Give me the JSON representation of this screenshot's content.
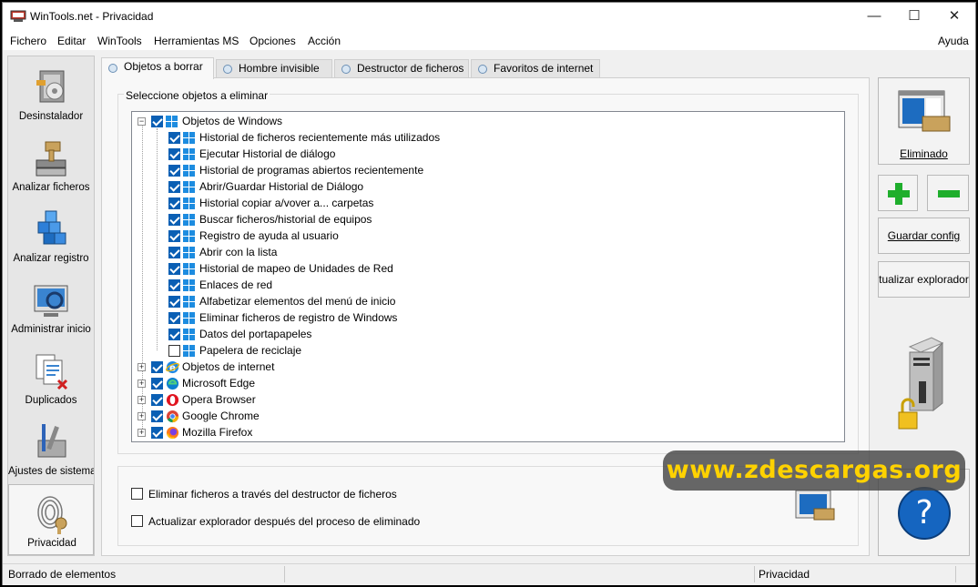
{
  "window": {
    "title": "WinTools.net - Privacidad"
  },
  "menu": {
    "items": [
      "Fichero",
      "Editar",
      "WinTools",
      "Herramientas MS",
      "Opciones",
      "Acción"
    ],
    "help": "Ayuda"
  },
  "sidebar": {
    "items": [
      {
        "label": "Desinstalador",
        "icon": "uninstaller-icon"
      },
      {
        "label": "Analizar ficheros",
        "icon": "file-scanner-icon"
      },
      {
        "label": "Analizar registro",
        "icon": "registry-scanner-icon"
      },
      {
        "label": "Administrar inicio",
        "icon": "startup-manager-icon"
      },
      {
        "label": "Duplicados",
        "icon": "duplicates-icon"
      },
      {
        "label": "Ajustes de sistema",
        "icon": "system-tweaks-icon"
      },
      {
        "label": "Privacidad",
        "icon": "privacy-icon",
        "active": true
      }
    ]
  },
  "tabs": [
    "Objetos a borrar",
    "Hombre invisible",
    "Destructor de ficheros",
    "Favoritos de internet"
  ],
  "group": {
    "title": "Seleccione objetos a eliminar"
  },
  "tree": {
    "root": {
      "label": "Objetos de Windows",
      "checked": true,
      "expanded": true
    },
    "children": [
      {
        "label": "Historial de ficheros recientemente más utilizados",
        "checked": true
      },
      {
        "label": "Ejecutar Historial de diálogo",
        "checked": true
      },
      {
        "label": "Historial de programas abiertos recientemente",
        "checked": true
      },
      {
        "label": "Abrir/Guardar Historial de Diálogo",
        "checked": true
      },
      {
        "label": "Historial copiar a/vover a... carpetas",
        "checked": true
      },
      {
        "label": "Buscar ficheros/historial de equipos",
        "checked": true
      },
      {
        "label": "Registro de ayuda al usuario",
        "checked": true
      },
      {
        "label": "Abrir con la lista",
        "checked": true
      },
      {
        "label": "Historial de mapeo de Unidades de Red",
        "checked": true
      },
      {
        "label": "Enlaces de red",
        "checked": true
      },
      {
        "label": "Alfabetizar elementos del menú de inicio",
        "checked": true
      },
      {
        "label": "Eliminar ficheros de registro de Windows",
        "checked": true
      },
      {
        "label": "Datos del portapapeles",
        "checked": true
      },
      {
        "label": "Papelera de reciclaje",
        "checked": false
      }
    ],
    "others": [
      {
        "label": "Objetos de internet",
        "checked": true,
        "icon": "ie-icon"
      },
      {
        "label": "Microsoft Edge",
        "checked": true,
        "icon": "edge-icon"
      },
      {
        "label": "Opera Browser",
        "checked": true,
        "icon": "opera-icon"
      },
      {
        "label": "Google Chrome",
        "checked": true,
        "icon": "chrome-icon"
      },
      {
        "label": "Mozilla Firefox",
        "checked": true,
        "icon": "firefox-icon"
      }
    ]
  },
  "options": [
    {
      "label": "Eliminar ficheros a través del destructor de ficheros",
      "checked": false
    },
    {
      "label": "Actualizar explorador después del proceso de eliminado",
      "checked": false
    }
  ],
  "right": {
    "eliminado_label": "Eliminado",
    "guardar_label": "Guardar config",
    "actualizar_label": "Actualizar explorador",
    "help_label": "?"
  },
  "status": {
    "left": "Borrado de elementos",
    "right": "Privacidad"
  },
  "watermark": "www.zdescargas.org",
  "colors": {
    "accent": "#0a5fb4",
    "windows_blue": "#1d8ce0",
    "watermark_text": "#ffd200"
  }
}
